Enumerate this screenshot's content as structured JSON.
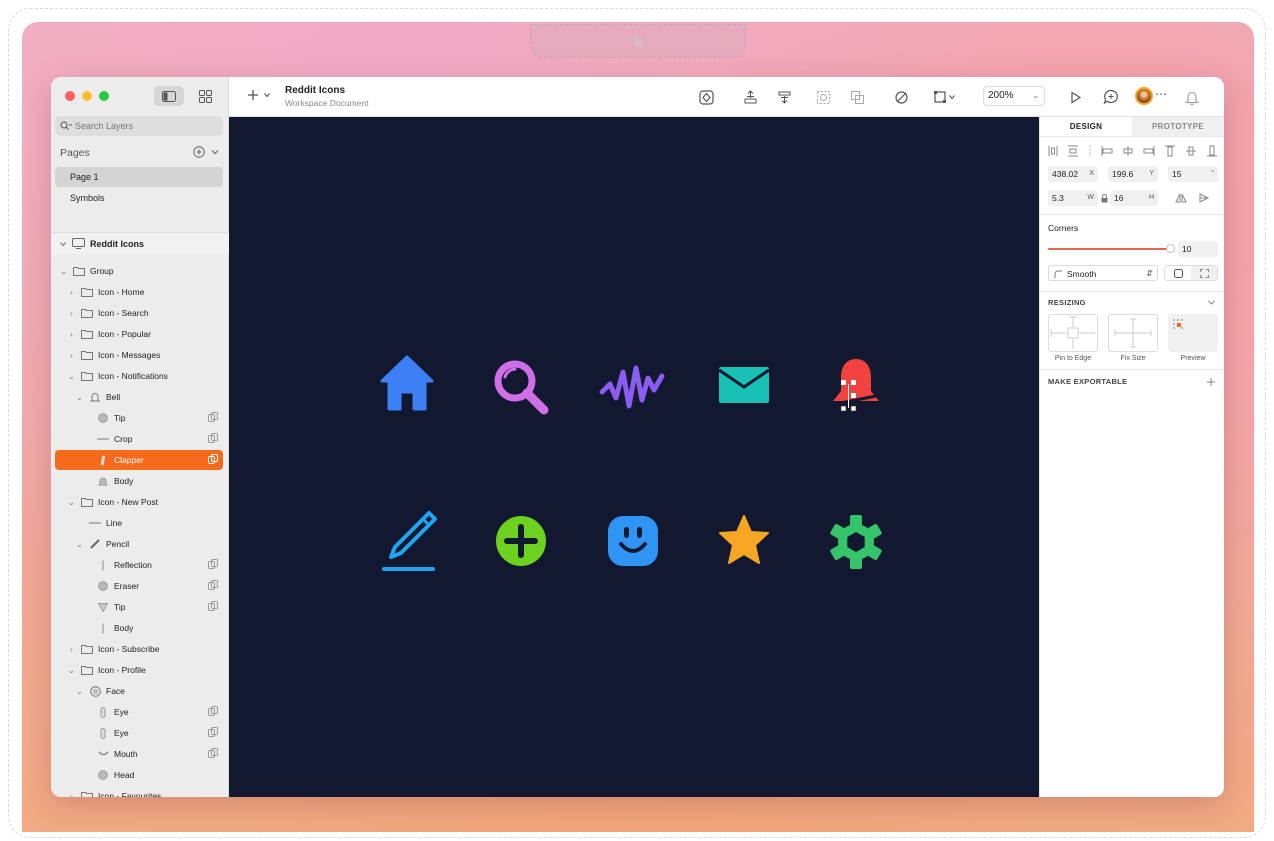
{
  "app": {
    "doc_title": "Reddit Icons",
    "doc_subtitle": "Workspace Document",
    "zoom": "200%"
  },
  "sidebar": {
    "search_placeholder": "Search Layers",
    "pages_label": "Pages",
    "pages": [
      "Page 1",
      "Symbols"
    ],
    "selected_page": "Page 1",
    "artboard": "Reddit Icons",
    "layers": [
      {
        "label": "Group",
        "indent": 1,
        "arrow": "open",
        "icon": "folder-icon"
      },
      {
        "label": "Icon - Home",
        "indent": 2,
        "arrow": "closed",
        "icon": "folder-icon"
      },
      {
        "label": "Icon - Search",
        "indent": 2,
        "arrow": "closed",
        "icon": "folder-icon"
      },
      {
        "label": "Icon - Popular",
        "indent": 2,
        "arrow": "closed",
        "icon": "folder-icon"
      },
      {
        "label": "Icon - Messages",
        "indent": 2,
        "arrow": "closed",
        "icon": "folder-icon"
      },
      {
        "label": "Icon - Notifications",
        "indent": 2,
        "arrow": "open",
        "icon": "folder-icon"
      },
      {
        "label": "Bell",
        "indent": 3,
        "arrow": "open",
        "icon": "bell-shape-icon"
      },
      {
        "label": "Tip",
        "indent": 4,
        "arrow": "",
        "icon": "oval-shape-icon",
        "mask": true
      },
      {
        "label": "Crop",
        "indent": 4,
        "arrow": "",
        "icon": "line-shape-icon",
        "mask": true
      },
      {
        "label": "Clapper",
        "indent": 4,
        "arrow": "",
        "icon": "path-shape-icon",
        "mask": true,
        "selected": true
      },
      {
        "label": "Body",
        "indent": 4,
        "arrow": "",
        "icon": "bell-body-shape-icon"
      },
      {
        "label": "Icon - New Post",
        "indent": 2,
        "arrow": "open",
        "icon": "folder-icon"
      },
      {
        "label": "Line",
        "indent": 3,
        "arrow": "",
        "icon": "line-shape-icon"
      },
      {
        "label": "Pencil",
        "indent": 3,
        "arrow": "open",
        "icon": "pencil-shape-icon"
      },
      {
        "label": "Reflection",
        "indent": 4,
        "arrow": "",
        "icon": "vertical-line-shape-icon",
        "mask": true
      },
      {
        "label": "Eraser",
        "indent": 4,
        "arrow": "",
        "icon": "oval-shape-icon",
        "mask": true
      },
      {
        "label": "Tip",
        "indent": 4,
        "arrow": "",
        "icon": "triangle-shape-icon",
        "mask": true
      },
      {
        "label": "Body",
        "indent": 4,
        "arrow": "",
        "icon": "vertical-line-shape-icon"
      },
      {
        "label": "Icon - Subscribe",
        "indent": 2,
        "arrow": "closed",
        "icon": "folder-icon"
      },
      {
        "label": "Icon - Profile",
        "indent": 2,
        "arrow": "open",
        "icon": "folder-icon"
      },
      {
        "label": "Face",
        "indent": 3,
        "arrow": "open",
        "icon": "face-shape-icon"
      },
      {
        "label": "Eye",
        "indent": 4,
        "arrow": "",
        "icon": "eye-shape-icon",
        "mask": true
      },
      {
        "label": "Eye",
        "indent": 4,
        "arrow": "",
        "icon": "eye-shape-icon",
        "mask": true
      },
      {
        "label": "Mouth",
        "indent": 4,
        "arrow": "",
        "icon": "mouth-shape-icon",
        "mask": true
      },
      {
        "label": "Head",
        "indent": 4,
        "arrow": "",
        "icon": "oval-shape-icon"
      },
      {
        "label": "Icon - Favourites",
        "indent": 2,
        "arrow": "closed",
        "icon": "folder-icon"
      }
    ]
  },
  "canvas": {
    "background": "#121830",
    "icons_row1": [
      "home-icon",
      "search-icon",
      "popular-wave-icon",
      "messages-envelope-icon",
      "notifications-bell-icon"
    ],
    "icons_row2": [
      "new-post-pencil-icon",
      "subscribe-plus-icon",
      "profile-face-icon",
      "favourites-star-icon",
      "settings-gear-icon"
    ],
    "colors": {
      "home": "#3d7ff5",
      "search": "#d06ee8",
      "popular": "#8a5cf0",
      "messages": "#17c1b3",
      "bell": "#f0433f",
      "pencil": "#1ea7f0",
      "plus": "#6cd11f",
      "face": "#2f95f5",
      "star": "#f6a623",
      "gear": "#35c46a"
    }
  },
  "inspector": {
    "tab_design": "DESIGN",
    "tab_prototype": "PROTOTYPE",
    "x": "438.02",
    "x_label": "X",
    "y": "199.6",
    "y_label": "Y",
    "rotation": "15",
    "rotation_unit": "°",
    "w": "5.3",
    "w_label": "W",
    "h": "16",
    "h_label": "H",
    "corners_label": "Corners",
    "corners_value": "10",
    "smooth_label": "Smooth",
    "resizing_label": "RESIZING",
    "pin_to_edge": "Pin to Edge",
    "fix_size": "Fix Size",
    "preview": "Preview",
    "make_exportable": "MAKE EXPORTABLE"
  }
}
